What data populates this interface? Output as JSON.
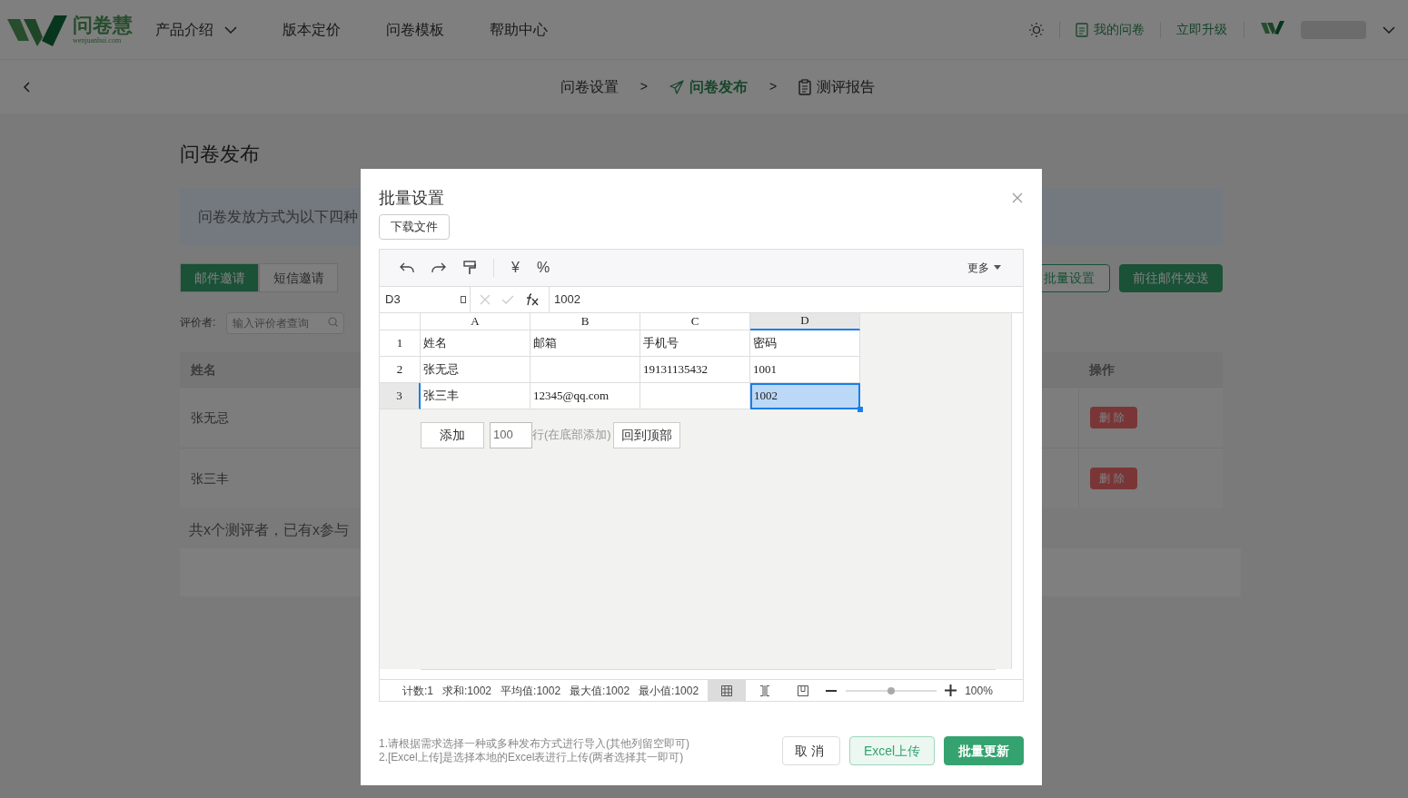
{
  "nav": {
    "logo_text": "问卷慧",
    "logo_domain": "wenjuanhui.com",
    "items": [
      {
        "label": "产品介绍",
        "has_dropdown": true
      },
      {
        "label": "版本定价",
        "has_dropdown": false
      },
      {
        "label": "问卷模板",
        "has_dropdown": false
      },
      {
        "label": "帮助中心",
        "has_dropdown": false
      }
    ],
    "my_surveys": "我的问卷",
    "upgrade": "立即升级"
  },
  "breadcrumb": [
    {
      "label": "问卷设置",
      "kind": "plain",
      "selected": false
    },
    {
      "label": "问卷发布",
      "kind": "send",
      "selected": true
    },
    {
      "label": "测评报告",
      "kind": "report",
      "selected": false
    }
  ],
  "breadcrumb_separator": ">",
  "page": {
    "title": "问卷发布",
    "notice": "问卷发放方式为以下四种",
    "tabs": [
      {
        "label": "邮件邀请",
        "selected": true
      },
      {
        "label": "短信邀请",
        "selected": false
      }
    ],
    "actions": [
      {
        "label": "批量设置",
        "kind": "outline"
      },
      {
        "label": "前往邮件发送",
        "kind": "primary"
      }
    ],
    "filter": {
      "label": "评价者:",
      "placeholder": "输入评价者查询"
    },
    "table": {
      "columns": [
        "姓名",
        "操作"
      ],
      "rows": [
        {
          "name": "张无忌",
          "action": "删除"
        },
        {
          "name": "张三丰",
          "action": "删除"
        }
      ]
    },
    "summary": "共x个测评者，已有x参与"
  },
  "modal": {
    "title": "批量设置",
    "download_button": "下载文件",
    "toolbar": {
      "tools": [
        {
          "kind": "undo"
        },
        {
          "kind": "redo"
        },
        {
          "kind": "painter"
        },
        {
          "kind": "divider"
        },
        {
          "kind": "text",
          "label": "¥"
        },
        {
          "kind": "text",
          "label": "%"
        }
      ],
      "more": "更多"
    },
    "formula": {
      "cell_ref": "D3",
      "value": "1002"
    },
    "grid": {
      "columns": [
        {
          "label": "A",
          "selected": false
        },
        {
          "label": "B",
          "selected": false
        },
        {
          "label": "C",
          "selected": false
        },
        {
          "label": "D",
          "selected": true
        }
      ],
      "rows": [
        {
          "number": "1",
          "selected": false,
          "cells": [
            {
              "text": "姓名",
              "selected": false
            },
            {
              "text": "邮箱",
              "selected": false
            },
            {
              "text": "手机号",
              "selected": false
            },
            {
              "text": "密码",
              "selected": false
            }
          ]
        },
        {
          "number": "2",
          "selected": false,
          "cells": [
            {
              "text": "张无忌",
              "selected": false
            },
            {
              "selected": false
            },
            {
              "text": "19131135432",
              "selected": false
            },
            {
              "text": "1001",
              "selected": false
            }
          ]
        },
        {
          "number": "3",
          "selected": true,
          "cells": [
            {
              "text": "张三丰",
              "selected": false
            },
            {
              "text": "12345@qq.com",
              "selected": false
            },
            {
              "selected": false
            },
            {
              "text": "1002",
              "selected": true
            }
          ]
        }
      ]
    },
    "add_bar": {
      "button": "添加",
      "count": "100",
      "hint": "行(在底部添加)",
      "top_button": "回到顶部"
    },
    "status": {
      "stats": [
        "计数:1",
        "求和:1002",
        "平均值:1002",
        "最大值:1002",
        "最小值:1002"
      ],
      "views": [
        {
          "kind": "grid",
          "selected": true
        },
        {
          "kind": "page-break",
          "selected": false
        },
        {
          "kind": "page-layout",
          "selected": false
        }
      ],
      "zoom": {
        "level": 0.5,
        "reading": "100%"
      }
    },
    "notes": [
      "1.请根据需求选择一种或多种发布方式进行导入(其他列留空即可)",
      "2.[Excel上传]是选择本地的Excel表进行上传(两者选择其一即可)"
    ],
    "buttons": [
      {
        "label": "取消",
        "kind": "default"
      },
      {
        "label": "Excel上传",
        "kind": "outline"
      },
      {
        "label": "批量更新",
        "kind": "primary"
      }
    ]
  }
}
